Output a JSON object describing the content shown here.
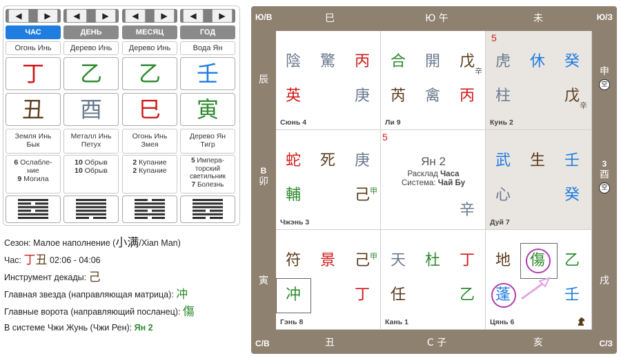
{
  "left": {
    "columns": [
      {
        "tab": "ЧАС",
        "active": true,
        "element": "Огонь Инь",
        "stem": "丁",
        "stem_color": "#d01919",
        "branch": "丑",
        "branch_color": "#5a3b1c",
        "branch_l1": "Земля Инь",
        "branch_l2": "Бык",
        "st1a": "6",
        "st1b": " Ослабле-",
        "st1c": "ние",
        "st2a": "9",
        "st2b": " Могила"
      },
      {
        "tab": "ДЕНЬ",
        "active": false,
        "element": "Дерево Инь",
        "stem": "乙",
        "stem_color": "#2f8a2f",
        "branch": "酉",
        "branch_color": "#6a7a8f",
        "branch_l1": "Металл Инь",
        "branch_l2": "Петух",
        "st1a": "10",
        "st1b": " Обрыв",
        "st1c": "",
        "st2a": "10",
        "st2b": " Обрыв"
      },
      {
        "tab": "МЕСЯЦ",
        "active": false,
        "element": "Дерево Инь",
        "stem": "乙",
        "stem_color": "#2f8a2f",
        "branch": "巳",
        "branch_color": "#d01919",
        "branch_l1": "Огонь Инь",
        "branch_l2": "Змея",
        "st1a": "2",
        "st1b": " Купание",
        "st1c": "",
        "st2a": "2",
        "st2b": " Купание"
      },
      {
        "tab": "ГОД",
        "active": false,
        "element": "Вода Ян",
        "stem": "壬",
        "stem_color": "#1f7de0",
        "branch": "寅",
        "branch_color": "#2f8a2f",
        "branch_l1": "Дерево Ян",
        "branch_l2": "Тигр",
        "st1a": "5",
        "st1b": " Импера-",
        "st1c": "торский светильник",
        "st2a": "7",
        "st2b": " Болезнь"
      }
    ],
    "hexagrams": [
      [
        1,
        0,
        1,
        0,
        1,
        1
      ],
      [
        1,
        1,
        1,
        1,
        1,
        0
      ],
      [
        0,
        1,
        1,
        0,
        1,
        0
      ],
      [
        1,
        1,
        1,
        0,
        1,
        0
      ]
    ]
  },
  "info": {
    "season_label": "Сезон: Малое наполнение (",
    "season_glyph": "小满",
    "season_tail": "/Xian Man)",
    "hour_label": "Час: ",
    "hour_glyph1": "丁",
    "hour_glyph2": "丑",
    "hour_time": " 02:06 - 04:06",
    "decade_label": "Инструмент декады: ",
    "decade_glyph": "己",
    "star_label": "Главная звезда (направляющая матрица): ",
    "star_glyph": "冲",
    "gate_label": "Главные ворота (направляющий посланец): ",
    "gate_glyph": "傷",
    "system_label": "В системе Чжи Жунь (Чжи Рен): ",
    "system_value": "Ян 2"
  },
  "chart": {
    "corners": {
      "tl": "Ю/В",
      "tr": "Ю/З",
      "bl": "С/В",
      "br": "С/З"
    },
    "top": [
      "巳",
      "Ю 午",
      "未"
    ],
    "bottom": [
      "丑",
      "С 子",
      "亥"
    ],
    "left": {
      "l1": "辰",
      "l2_dir": "В",
      "l2_ch": "卯",
      "l3": "寅"
    },
    "right": {
      "r1": "申",
      "r1_mark": "空",
      "r2_dir": "3",
      "r2_ch": "酉",
      "r2_mark": "空",
      "r3": "戌"
    },
    "palaces": {
      "xun": {
        "name": "Сюнь 4",
        "g1": "陰",
        "g2": "驚",
        "g3": "丙",
        "g4": "英",
        "g6": "庚"
      },
      "li": {
        "name": "Ли 9",
        "g1": "合",
        "g2": "開",
        "g3": "戊",
        "sub3": "辛",
        "g4": "芮",
        "g5": "禽",
        "g6": "丙"
      },
      "kun": {
        "name": "Кунь 2",
        "num": "5",
        "g1": "虎",
        "g2": "休",
        "g3": "癸",
        "g4": "柱",
        "g6": "戊",
        "sub6": "辛"
      },
      "zhen": {
        "name": "Чжэнь 3",
        "g1": "蛇",
        "g2": "死",
        "g3": "庚",
        "g4": "輔",
        "g6": "己",
        "sub6": "甲"
      },
      "center": {
        "num": "5",
        "big": "Ян 2",
        "l1a": "Расклад ",
        "l1b": "Часа",
        "l2a": "Система: ",
        "l2b": "Чай Бу",
        "g6": "辛"
      },
      "dui": {
        "name": "Дуй 7",
        "g1": "武",
        "g2": "生",
        "g3": "壬",
        "g4": "心",
        "g6": "癸"
      },
      "gen": {
        "name": "Гэнь 8",
        "g1": "符",
        "g2": "景",
        "g3": "己",
        "sub3": "甲",
        "g4": "冲",
        "g6": "丁"
      },
      "kan": {
        "name": "Кань 1",
        "g1": "天",
        "g2": "杜",
        "g3": "丁",
        "g4": "任",
        "g6": "乙"
      },
      "qian": {
        "name": "Цянь 6",
        "g1": "地",
        "g2": "傷",
        "g3": "乙",
        "g4": "蓬",
        "g6": "壬",
        "icon": "horse-icon"
      }
    }
  }
}
